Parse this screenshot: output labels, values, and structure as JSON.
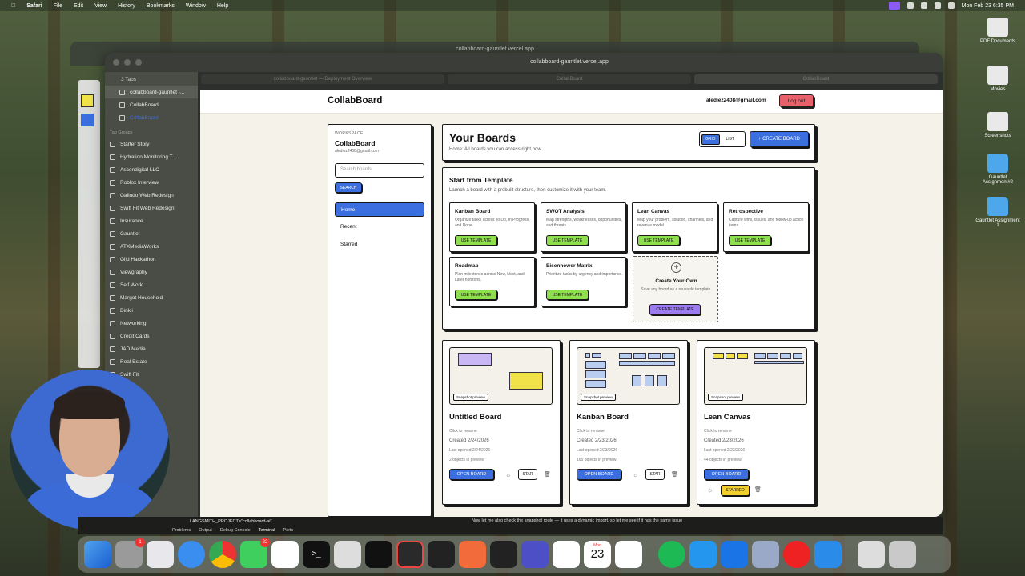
{
  "menubar": {
    "app": "Safari",
    "items": [
      "File",
      "Edit",
      "View",
      "History",
      "Bookmarks",
      "Window",
      "Help"
    ],
    "clock": "Mon Feb 23  6:35 PM"
  },
  "bg_window": {
    "url": "collabboard-gauntlet.vercel.app"
  },
  "browser": {
    "url": "collabboard-gauntlet.vercel.app",
    "tabs": [
      "collabboard-gauntlet — Deployment Overview",
      "CollabBoard",
      "CollabBoard"
    ],
    "sidebar": {
      "tab_count": "3 Tabs",
      "tabs": [
        "collabboard-gauntlet -...",
        "CollabBoard",
        "CollabBoard"
      ],
      "groups_label": "Tab Groups",
      "groups": [
        "Starter Story",
        "Hydration Monitoring T...",
        "Ascendigital LLC",
        "Roblox Interview",
        "Galindo Web Redesign",
        "Swift Fit Web Redesign",
        "Insurance",
        "Gauntlet",
        "ATXMediaWorks",
        "Glid Hackathon",
        "Viewgraphy",
        "Self Work",
        "Margot Household",
        "Dinkli",
        "Networking",
        "Credit Cards",
        "JAD Media",
        "Real Estate",
        "Swift Fit"
      ]
    }
  },
  "app": {
    "brand": "CollabBoard",
    "email": "alediez2408@gmail.com",
    "logout": "Log out",
    "workspace": {
      "label": "WORKSPACE",
      "name": "CollabBoard",
      "email": "alediez2408@gmail.com",
      "search_placeholder": "Search boards",
      "search_btn": "SEARCH",
      "nav": [
        "Home",
        "Recent",
        "Starred"
      ]
    },
    "header": {
      "title": "Your Boards",
      "subtitle": "Home: All boards you can access right now.",
      "grid": "GRID",
      "list": "LIST",
      "create": "+ CREATE BOARD"
    },
    "templates": {
      "title": "Start from Template",
      "subtitle": "Launch a board with a prebuilt structure, then customize it with your team.",
      "use": "USE TEMPLATE",
      "items": [
        {
          "name": "Kanban Board",
          "desc": "Organize tasks across To Do, In Progress, and Done."
        },
        {
          "name": "SWOT Analysis",
          "desc": "Map strengths, weaknesses, opportunities, and threats."
        },
        {
          "name": "Lean Canvas",
          "desc": "Map your problem, solution, channels, and revenue model."
        },
        {
          "name": "Retrospective",
          "desc": "Capture wins, issues, and follow-up action items."
        },
        {
          "name": "Roadmap",
          "desc": "Plan milestones across Now, Next, and Later horizons."
        },
        {
          "name": "Eisenhower Matrix",
          "desc": "Prioritize tasks by urgency and importance."
        }
      ],
      "own": {
        "title": "Create Your Own",
        "desc": "Save any board as a reusable template.",
        "btn": "CREATE TEMPLATE"
      }
    },
    "boards": [
      {
        "title": "Untitled Board",
        "rename": "Click to rename",
        "created": "Created 2/24/2026",
        "opened": "Last opened 2/24/2026",
        "objects": "2 objects in preview",
        "open": "OPEN BOARD",
        "star": "STAR",
        "preview": "Snapshot preview"
      },
      {
        "title": "Kanban Board",
        "rename": "Click to rename",
        "created": "Created 2/23/2026",
        "opened": "Last opened 2/23/2026",
        "objects": "165 objects in preview",
        "open": "OPEN BOARD",
        "star": "STAR",
        "preview": "Snapshot preview"
      },
      {
        "title": "Lean Canvas",
        "rename": "Click to rename",
        "created": "Created 2/23/2026",
        "opened": "Last opened 2/23/2026",
        "objects": "44 objects in preview",
        "open": "OPEN BOARD",
        "star": "STARRED",
        "preview": "Snapshot preview"
      }
    ]
  },
  "terminal": {
    "line1": "LANGSMITH_PROJECT=\"collabboard-ai\"",
    "tabs": [
      "Problems",
      "Output",
      "Debug Console",
      "Terminal",
      "Ports"
    ],
    "chat": "Now let me also check the snapshot route — it uses a dynamic import, so let me see if it has the same issue"
  },
  "desktop": [
    "PDF Documents",
    "Movies",
    "Screenshots",
    "Gauntlet Assignment#2",
    "Gauntlet Assignment 1"
  ],
  "dock": {
    "calendar_month": "Mon",
    "calendar_day": "23",
    "badges": [
      "1",
      "22"
    ]
  },
  "colors": {
    "accent": "#3b6fe0",
    "green": "#8ee04a",
    "purple": "#9d7cf0",
    "yellow": "#f2cf2a",
    "red": "#e8606a",
    "bg": "#f5f2ea"
  }
}
